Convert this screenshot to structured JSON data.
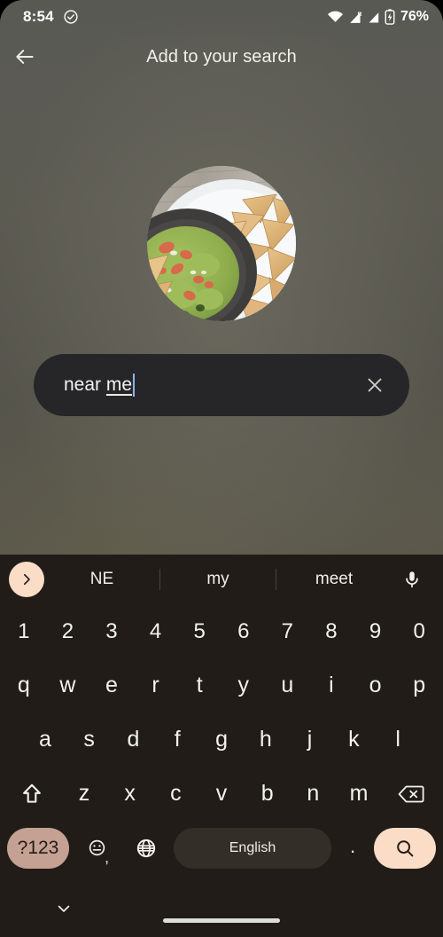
{
  "status_bar": {
    "time": "8:54",
    "battery_percent": "76%",
    "icons": [
      "check-circle-icon",
      "wifi-icon",
      "cellular-signal-roaming-icon",
      "cellular-signal-icon",
      "battery-charging-icon"
    ]
  },
  "app_bar": {
    "title": "Add to your search",
    "back_icon": "arrow-back-icon"
  },
  "content": {
    "thumbnail_alt": "Guacamole in a dark bowl with tortilla chips on a white plate"
  },
  "search": {
    "committed_text": "near ",
    "composing_text": "me",
    "full_value": "near me",
    "placeholder": "Add to your search",
    "clear_icon": "close-icon"
  },
  "keyboard": {
    "expand_icon": "chevron-right-icon",
    "mic_icon": "microphone-icon",
    "suggestions": [
      "NE",
      "my",
      "meet"
    ],
    "rows": {
      "numbers": [
        "1",
        "2",
        "3",
        "4",
        "5",
        "6",
        "7",
        "8",
        "9",
        "0"
      ],
      "top": [
        "q",
        "w",
        "e",
        "r",
        "t",
        "y",
        "u",
        "i",
        "o",
        "p"
      ],
      "home": [
        "a",
        "s",
        "d",
        "f",
        "g",
        "h",
        "j",
        "k",
        "l"
      ],
      "bottom": [
        "z",
        "x",
        "c",
        "v",
        "b",
        "n",
        "m"
      ]
    },
    "shift_icon": "shift-icon",
    "backspace_icon": "backspace-icon",
    "symbols_key": "?123",
    "emoji_icon": "emoji-icon",
    "comma_key": ",",
    "globe_icon": "globe-language-icon",
    "spacebar_label": "English",
    "period_key": ".",
    "search_icon": "search-icon",
    "hide_keyboard_icon": "chevron-down-icon"
  },
  "colors": {
    "accent_peach": "#fbdcc6",
    "symbols_key": "#c5a193",
    "keyboard_bg": "#211c18",
    "spacebar": "#342e29",
    "search_chip": "#262628",
    "caret_blue": "#8ab4f8"
  }
}
